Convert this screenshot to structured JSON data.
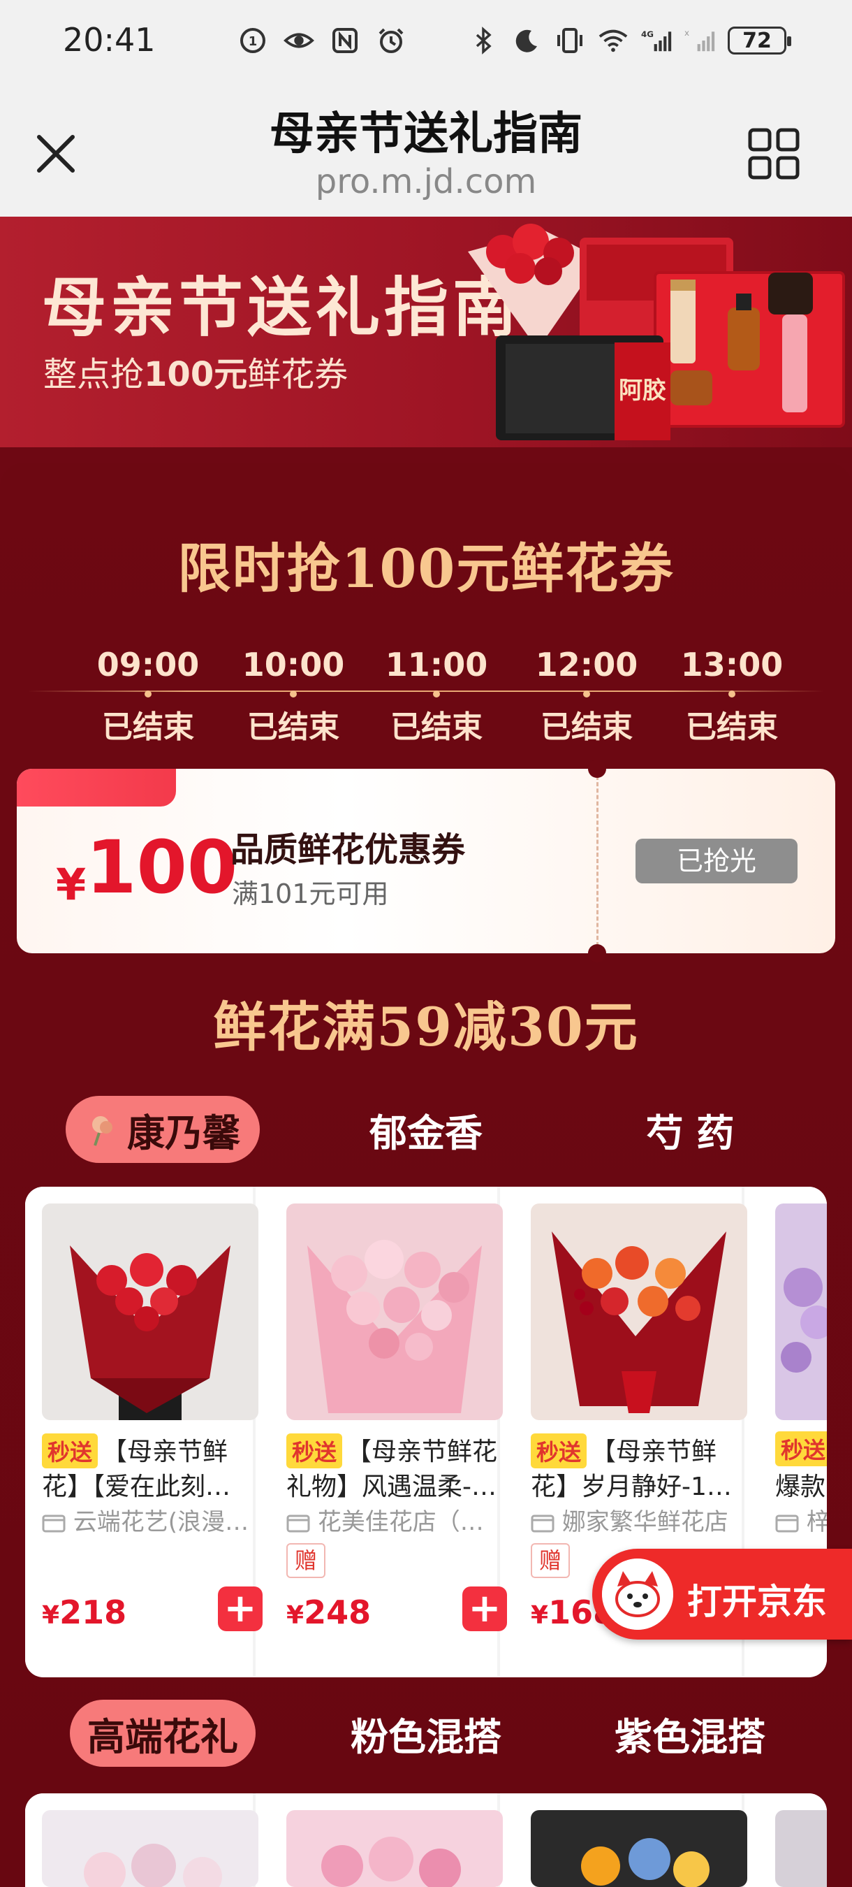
{
  "status": {
    "time": "20:41",
    "battery": "72",
    "left_icons": [
      "notification-badge-icon",
      "eye-icon",
      "nfc-icon",
      "alarm-icon"
    ],
    "right_icons": [
      "bluetooth-icon",
      "moon-icon",
      "vibrate-icon",
      "wifi-icon",
      "signal-4g-icon",
      "signal-x-icon"
    ]
  },
  "nav": {
    "title": "母亲节送礼指南",
    "url": "pro.m.jd.com"
  },
  "banner": {
    "title": "母亲节送礼指南",
    "subtitle_pre": "整点抢",
    "subtitle_bold": "100元",
    "subtitle_post": "鲜花券",
    "box_label": "阿胶"
  },
  "flash": {
    "title": "限时抢100元鲜花券",
    "slots": [
      {
        "time": "09:00",
        "status": "已结束"
      },
      {
        "time": "10:00",
        "status": "已结束"
      },
      {
        "time": "11:00",
        "status": "已结束"
      },
      {
        "time": "12:00",
        "status": "已结束"
      },
      {
        "time": "13:00",
        "status": "已结束"
      }
    ]
  },
  "coupon": {
    "symbol": "¥",
    "amount": "100",
    "name": "品质鲜花优惠券",
    "condition": "满101元可用",
    "button": "已抢光"
  },
  "promo_title": "鲜花满59减30元",
  "tabs1": [
    "康乃馨",
    "郁金香",
    "芍 药"
  ],
  "products": [
    {
      "badge": "秒送",
      "line1": "【母亲节鲜",
      "line2": "花】【爱在此刻…",
      "shop": "云端花艺(浪漫…",
      "gift": "",
      "price_symbol": "¥",
      "price": "218"
    },
    {
      "badge": "秒送",
      "line1": "【母亲节鲜花",
      "line2": "礼物】风遇温柔-…",
      "shop": "花美佳花店（…",
      "gift": "赠",
      "price_symbol": "¥",
      "price": "248"
    },
    {
      "badge": "秒送",
      "line1": "【母亲节鲜",
      "line2": "花】岁月静好-11…",
      "shop": "娜家繁华鲜花店",
      "gift": "赠",
      "price_symbol": "¥",
      "price": "168"
    },
    {
      "badge": "秒送",
      "line1": "",
      "line2": "爆款",
      "shop": "梓",
      "gift": "",
      "price_symbol": "",
      "price": ""
    }
  ],
  "tabs2": [
    "高端花礼",
    "粉色混搭",
    "紫色混搭"
  ],
  "open_jd": "打开京东",
  "colors": {
    "brand_red": "#e3162b",
    "panel_bg": "#6d0812",
    "gold_title": "#f8c78f",
    "tab_active": "#f77a7a"
  }
}
